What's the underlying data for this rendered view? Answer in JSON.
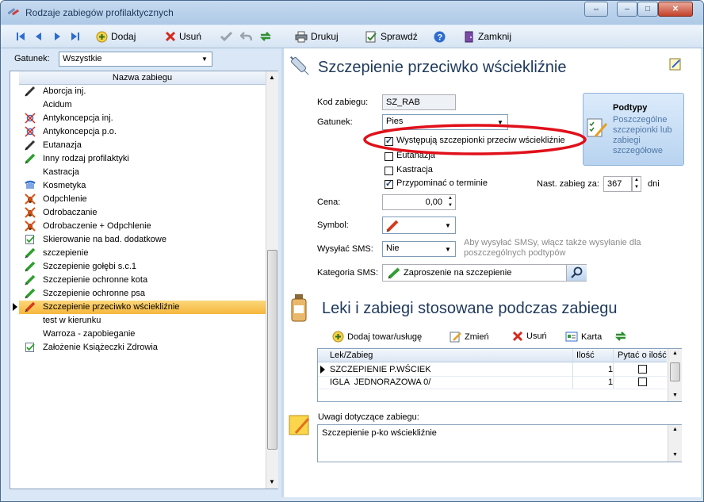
{
  "window": {
    "title": "Rodzaje zabiegów profilaktycznych",
    "buttons": {
      "restore": "⇔",
      "minimize": "–",
      "maximize": "□",
      "close": "✕"
    }
  },
  "toolbar": {
    "add_label": "Dodaj",
    "delete_label": "Usuń",
    "print_label": "Drukuj",
    "check_label": "Sprawdź",
    "close_label": "Zamknij"
  },
  "filter": {
    "label": "Gatunek:",
    "value": "Wszystkie"
  },
  "list": {
    "header": "Nazwa zabiegu",
    "rows": [
      {
        "label": "Aborcja inj.",
        "icon": "syringe-dark-icon"
      },
      {
        "label": "Acidum",
        "icon": ""
      },
      {
        "label": "Antykoncepcja inj.",
        "icon": "crossed-gender-icon"
      },
      {
        "label": "Antykoncepcja p.o.",
        "icon": "crossed-gender-icon"
      },
      {
        "label": "Eutanazja",
        "icon": "syringe-dark-icon"
      },
      {
        "label": "Inny rodzaj profilaktyki",
        "icon": "syringe-green-icon"
      },
      {
        "label": "Kastracja",
        "icon": ""
      },
      {
        "label": "Kosmetyka",
        "icon": "comb-icon"
      },
      {
        "label": "Odpchlenie",
        "icon": "crossed-bug-icon"
      },
      {
        "label": "Odrobaczanie",
        "icon": "crossed-bug-icon"
      },
      {
        "label": "Odrobaczenie + Odpchlenie",
        "icon": "crossed-bug-icon"
      },
      {
        "label": "Skierowanie na bad. dodatkowe",
        "icon": "checklist-icon"
      },
      {
        "label": "szczepienie",
        "icon": "syringe-green-icon"
      },
      {
        "label": "Szczepienie gołębi s.c.1",
        "icon": "syringe-green-icon"
      },
      {
        "label": "Szczepienie ochronne kota",
        "icon": "syringe-green-icon"
      },
      {
        "label": "Szczepienie ochronne psa",
        "icon": "syringe-green-icon"
      },
      {
        "label": "Szczepienie przeciwko wściekliźnie",
        "icon": "syringe-red-icon"
      },
      {
        "label": "test w kierunku",
        "icon": ""
      },
      {
        "label": "Warroza - zapobieganie",
        "icon": ""
      },
      {
        "label": "Założenie Książeczki Zdrowia",
        "icon": "checklist-icon"
      }
    ],
    "selected_index": 16
  },
  "detail": {
    "title": "Szczepienie przeciwko wściekliźnie",
    "kod_label": "Kod zabiegu:",
    "kod_value": "SZ_RAB",
    "gatunek_label": "Gatunek:",
    "gatunek_value": "Pies",
    "checkboxes": [
      {
        "label": "Występują szczepionki przeciw wściekliźnie",
        "checked": true
      },
      {
        "label": "Eutanazja",
        "checked": false
      },
      {
        "label": "Kastracja",
        "checked": false
      },
      {
        "label": "Przypominać o terminie",
        "checked": true
      }
    ],
    "next_label": "Nast. zabieg za:",
    "next_value": "367",
    "next_unit": "dni",
    "cena_label": "Cena:",
    "cena_value": "0,00",
    "symbol_label": "Symbol:",
    "sms_label": "Wysyłać SMS:",
    "sms_value": "Nie",
    "sms_hint": "Aby wysyłać SMSy, włącz także wysyłanie dla poszczególnych podtypów",
    "kategoria_label": "Kategoria SMS:",
    "kategoria_value": "Zaproszenie na szczepienie",
    "podtypy_title": "Podtypy",
    "podtypy_desc": "Poszczególne szczepionki lub zabiegi szczegółowe"
  },
  "meds": {
    "title": "Leki i zabiegi stosowane podczas zabiegu",
    "add_label": "Dodaj towar/usługę",
    "edit_label": "Zmień",
    "delete_label": "Usuń",
    "card_label": "Karta",
    "columns": [
      "Lek/Zabieg",
      "Ilość",
      "Pytać o ilość"
    ],
    "rows": [
      {
        "name": "SZCZEPIENIE P.WŚCIEK",
        "qty": "1",
        "ask": false
      },
      {
        "name": "IGLA  JEDNORAZOWA 0/",
        "qty": "1",
        "ask": false
      }
    ]
  },
  "notes": {
    "label": "Uwagi dotyczące zabiegu:",
    "value": "Szczepienie p-ko wściekliźnie"
  },
  "colors": {
    "selection": "#f6b73c",
    "highlight_oval": "#e0101a",
    "title_text": "#1e395b",
    "hint_text": "#8a8a8a"
  }
}
